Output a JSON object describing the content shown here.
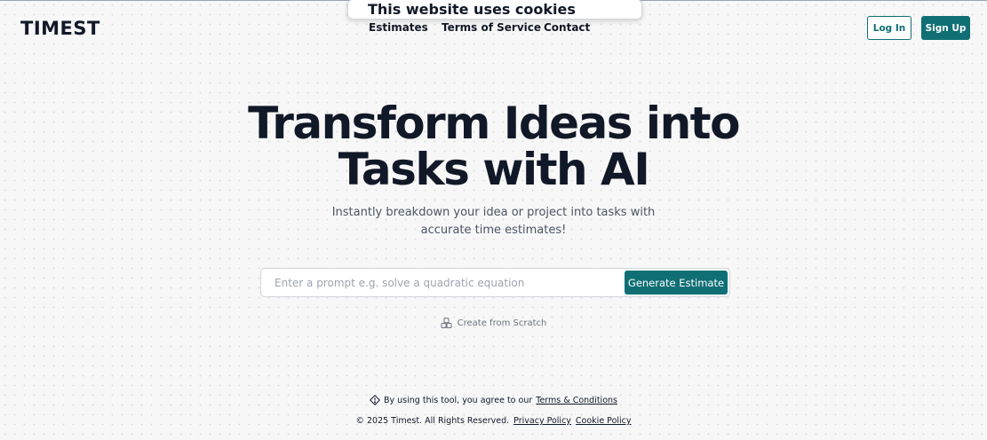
{
  "header": {
    "logo": "TIMEST",
    "nav": [
      {
        "label": "Estimates"
      },
      {
        "label": "Terms of Service"
      },
      {
        "label": "Contact"
      }
    ],
    "login_label": "Log In",
    "signup_label": "Sign Up"
  },
  "cookie_banner": {
    "text": "This website uses cookies"
  },
  "hero": {
    "title_line1": "Transform Ideas into",
    "title_line2": "Tasks with AI",
    "subtitle_line1": "Instantly breakdown your idea or project into tasks with",
    "subtitle_line2": "accurate time estimates!"
  },
  "prompt": {
    "placeholder": "Enter a prompt e.g. solve a quadratic equation",
    "value": "",
    "button_label": "Generate Estimate"
  },
  "scratch": {
    "label": "Create from Scratch",
    "icon": "blocks-icon"
  },
  "agreement": {
    "icon": "diamond-info-icon",
    "text": "By using this tool, you agree to our",
    "link": "Terms & Conditions"
  },
  "footer": {
    "copyright": "© 2025 Timest. All Rights Reserved.",
    "privacy": "Privacy Policy",
    "cookie": "Cookie Policy"
  },
  "colors": {
    "accent": "#0f6f74",
    "text": "#111827",
    "muted": "#6b7280",
    "background": "#f7f7f7"
  }
}
